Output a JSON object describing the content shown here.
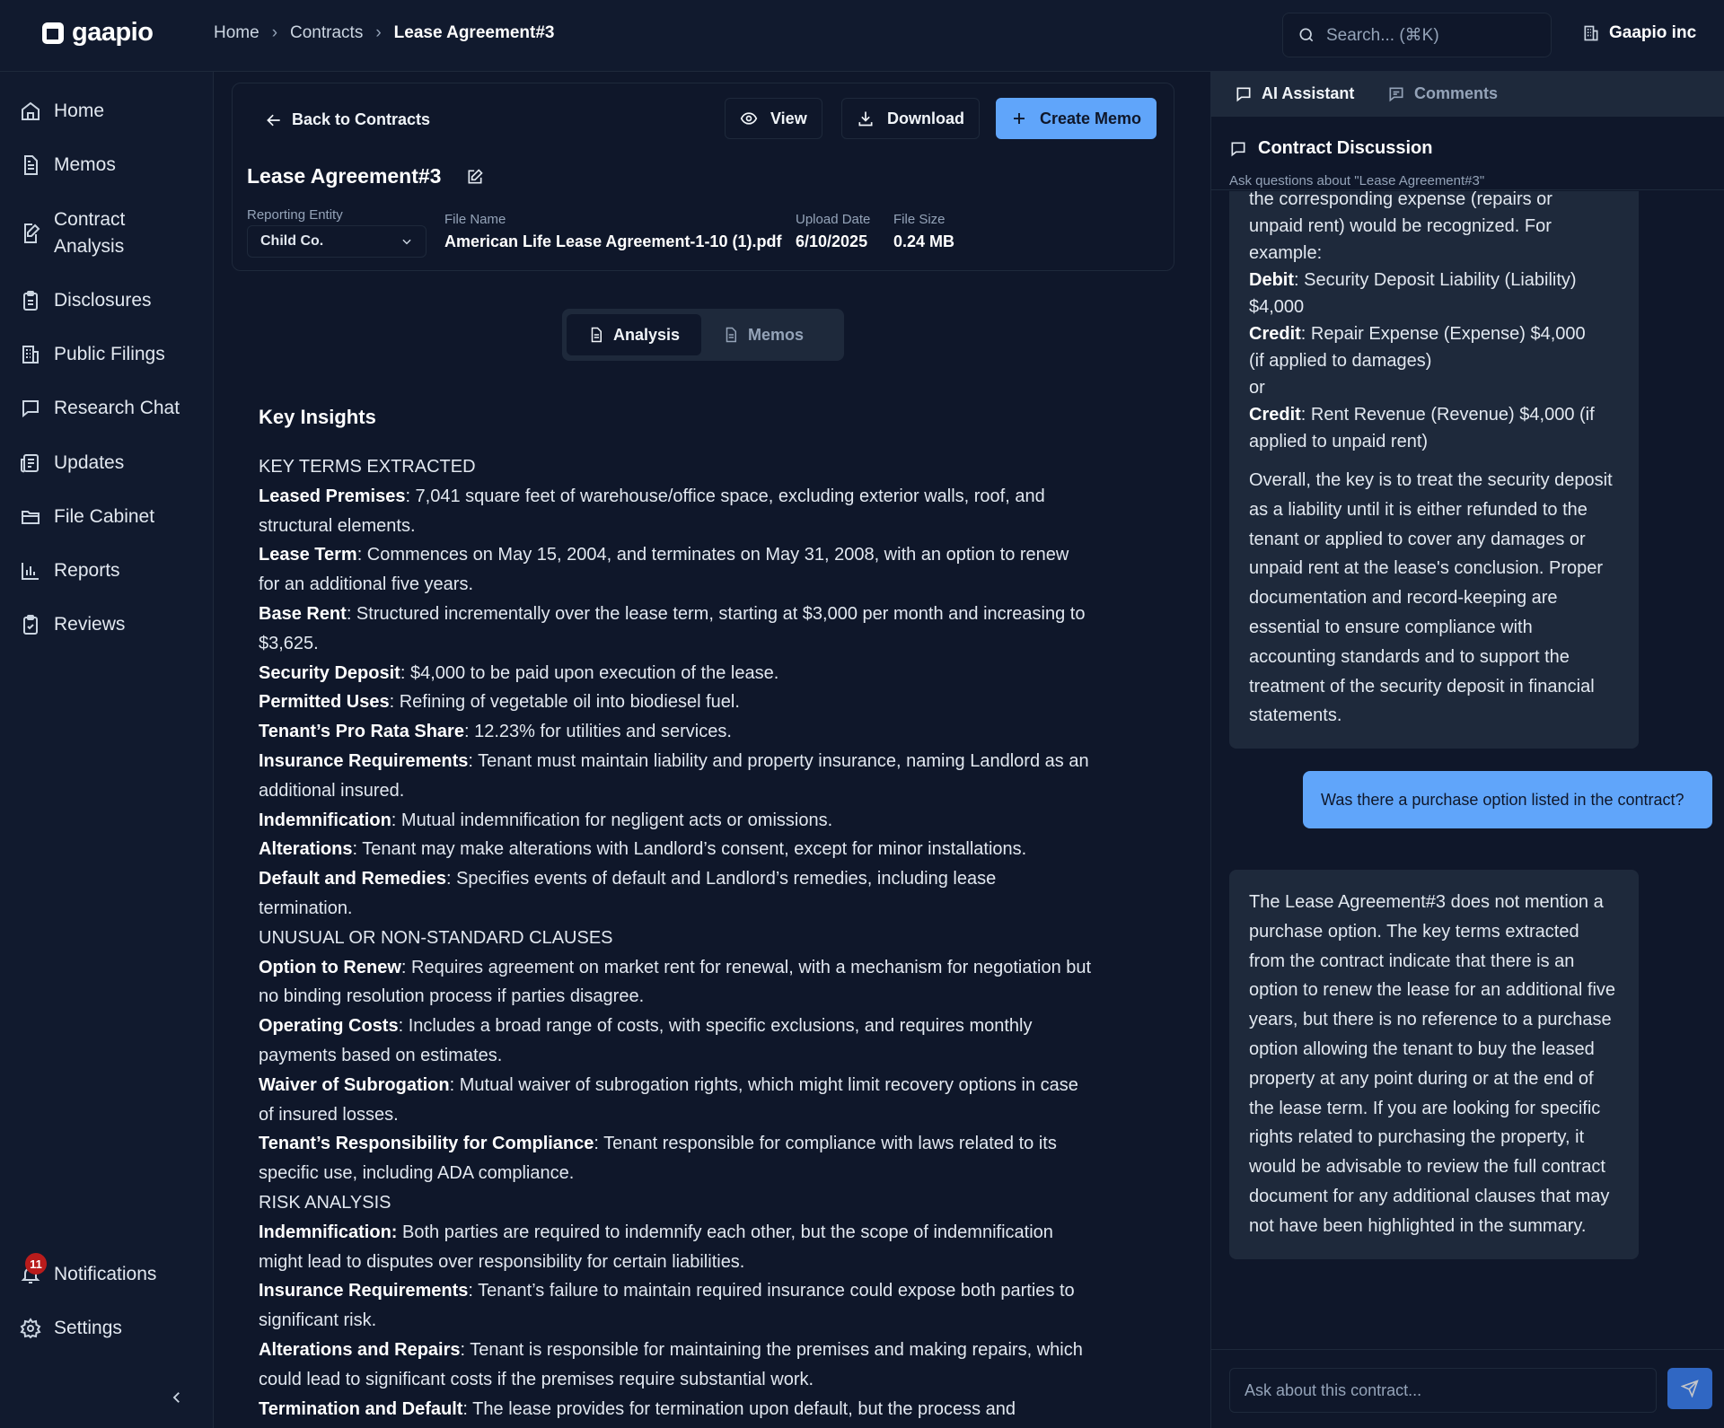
{
  "app": {
    "name": "gaapio",
    "org": "Gaapio inc"
  },
  "breadcrumb": [
    {
      "label": "Home"
    },
    {
      "label": "Contracts"
    },
    {
      "label": "Lease Agreement#3"
    }
  ],
  "search": {
    "placeholder": "Search... (⌘K)"
  },
  "sidebar": {
    "items": [
      {
        "label": "Home",
        "icon": "home-icon"
      },
      {
        "label": "Memos",
        "icon": "document-icon"
      },
      {
        "label_line1": "Contract",
        "label_line2": "Analysis",
        "icon": "file-edit-icon"
      },
      {
        "label": "Disclosures",
        "icon": "clipboard-icon"
      },
      {
        "label": "Public Filings",
        "icon": "building-icon"
      },
      {
        "label": "Research Chat",
        "icon": "chat-icon"
      },
      {
        "label": "Updates",
        "icon": "newspaper-icon"
      },
      {
        "label": "File Cabinet",
        "icon": "folder-icon"
      },
      {
        "label": "Reports",
        "icon": "bar-chart-icon"
      },
      {
        "label": "Reviews",
        "icon": "clipboard-check-icon"
      }
    ],
    "notifications": {
      "label": "Notifications",
      "count": "11"
    },
    "settings": {
      "label": "Settings"
    }
  },
  "header": {
    "back_label": "Back to Contracts",
    "view_label": "View",
    "download_label": "Download",
    "create_memo_label": "Create Memo",
    "title": "Lease Agreement#3",
    "reporting_entity_label": "Reporting Entity",
    "reporting_entity_value": "Child Co.",
    "file_name_label": "File Name",
    "file_name_value": "American Life Lease Agreement-1-10 (1).pdf",
    "upload_date_label": "Upload Date",
    "upload_date_value": "6/10/2025",
    "file_size_label": "File Size",
    "file_size_value": "0.24 MB"
  },
  "tabs": {
    "analysis": "Analysis",
    "memos": "Memos",
    "active": "analysis"
  },
  "insights": {
    "title": "Key Insights",
    "lines": [
      {
        "bold": "",
        "text": "KEY TERMS EXTRACTED"
      },
      {
        "bold": "Leased Premises",
        "text": ": 7,041 square feet of warehouse/office space, excluding exterior walls, roof, and"
      },
      {
        "bold": "",
        "text": "structural elements."
      },
      {
        "bold": "Lease Term",
        "text": ": Commences on May 15, 2004, and terminates on May 31, 2008, with an option to renew"
      },
      {
        "bold": "",
        "text": "for an additional five years."
      },
      {
        "bold": "Base Rent",
        "text": ": Structured incrementally over the lease term, starting at $3,000 per month and increasing to"
      },
      {
        "bold": "",
        "text": "$3,625."
      },
      {
        "bold": "Security Deposit",
        "text": ": $4,000 to be paid upon execution of the lease."
      },
      {
        "bold": "Permitted Uses",
        "text": ": Refining of vegetable oil into biodiesel fuel."
      },
      {
        "bold": "Tenant’s Pro Rata Share",
        "text": ": 12.23% for utilities and services."
      },
      {
        "bold": "Insurance Requirements",
        "text": ": Tenant must maintain liability and property insurance, naming Landlord as an"
      },
      {
        "bold": "",
        "text": "additional insured."
      },
      {
        "bold": "Indemnification",
        "text": ": Mutual indemnification for negligent acts or omissions."
      },
      {
        "bold": "Alterations",
        "text": ": Tenant may make alterations with Landlord’s consent, except for minor installations."
      },
      {
        "bold": "Default and Remedies",
        "text": ": Specifies events of default and Landlord’s remedies, including lease"
      },
      {
        "bold": "",
        "text": "termination."
      },
      {
        "bold": "",
        "text": "UNUSUAL OR NON-STANDARD CLAUSES"
      },
      {
        "bold": "Option to Renew",
        "text": ": Requires agreement on market rent for renewal, with a mechanism for negotiation but"
      },
      {
        "bold": "",
        "text": "no binding resolution process if parties disagree."
      },
      {
        "bold": "Operating Costs",
        "text": ": Includes a broad range of costs, with specific exclusions, and requires monthly"
      },
      {
        "bold": "",
        "text": "payments based on estimates."
      },
      {
        "bold": "Waiver of Subrogation",
        "text": ": Mutual waiver of subrogation rights, which might limit recovery options in case"
      },
      {
        "bold": "",
        "text": "of insured losses."
      },
      {
        "bold": "Tenant’s Responsibility for Compliance",
        "text": ": Tenant responsible for compliance with laws related to its"
      },
      {
        "bold": "",
        "text": "specific use, including ADA compliance."
      },
      {
        "bold": "",
        "text": "RISK ANALYSIS"
      },
      {
        "bold": "Indemnification:",
        "text": " Both parties are required to indemnify each other, but the scope of indemnification"
      },
      {
        "bold": "",
        "text": "might lead to disputes over responsibility for certain liabilities."
      },
      {
        "bold": "Insurance Requirements",
        "text": ": Tenant’s failure to maintain required insurance could expose both parties to"
      },
      {
        "bold": "",
        "text": "significant risk."
      },
      {
        "bold": "Alterations and Repairs",
        "text": ": Tenant is responsible for maintaining the premises and making repairs, which"
      },
      {
        "bold": "",
        "text": "could lead to significant costs if the premises require substantial work."
      },
      {
        "bold": "Termination and Default",
        "text": ": The lease provides for termination upon default, but the process and"
      }
    ]
  },
  "panel": {
    "tab_ai": "AI Assistant",
    "tab_comments": "Comments",
    "title": "Contract Discussion",
    "subtitle": "Ask questions about \"Lease Agreement#3\"",
    "msg1": {
      "l0": "the corresponding expense (repairs or",
      "l1": "unpaid rent) would be recognized. For",
      "l2": "example:",
      "debit_label": "Debit",
      "debit_text": ": Security Deposit Liability (Liability)",
      "debit_amount": "$4,000",
      "credit1_label": "Credit",
      "credit1_text": ": Repair Expense (Expense) $4,000",
      "credit1_note": "(if applied to damages)",
      "or": "or",
      "credit2_label": "Credit",
      "credit2_text": ": Rent Revenue (Revenue) $4,000 (if",
      "credit2_note": "applied to unpaid rent)",
      "overall": "Overall, the key is to treat the security deposit as a liability until it is either refunded to the tenant or applied to cover any damages or unpaid rent at the lease's conclusion. Proper documentation and record-keeping are essential to ensure compliance with accounting standards and to support the treatment of the security deposit in financial statements."
    },
    "user_msg": "Was there a purchase option listed in the contract?",
    "msg2": "The Lease Agreement#3 does not mention a purchase option. The key terms extracted from the contract indicate that there is an option to renew the lease for an additional five years, but there is no reference to a purchase option allowing the tenant to buy the leased property at any point during or at the end of the lease term. If you are looking for specific rights related to purchasing the property, it would be advisable to review the full contract document for any additional clauses that may not have been highlighted in the summary.",
    "input_placeholder": "Ask about this contract..."
  },
  "colors": {
    "accent": "#60a5fa",
    "background": "#0f172a",
    "card": "#1e293b",
    "badge": "#b91c1c"
  }
}
